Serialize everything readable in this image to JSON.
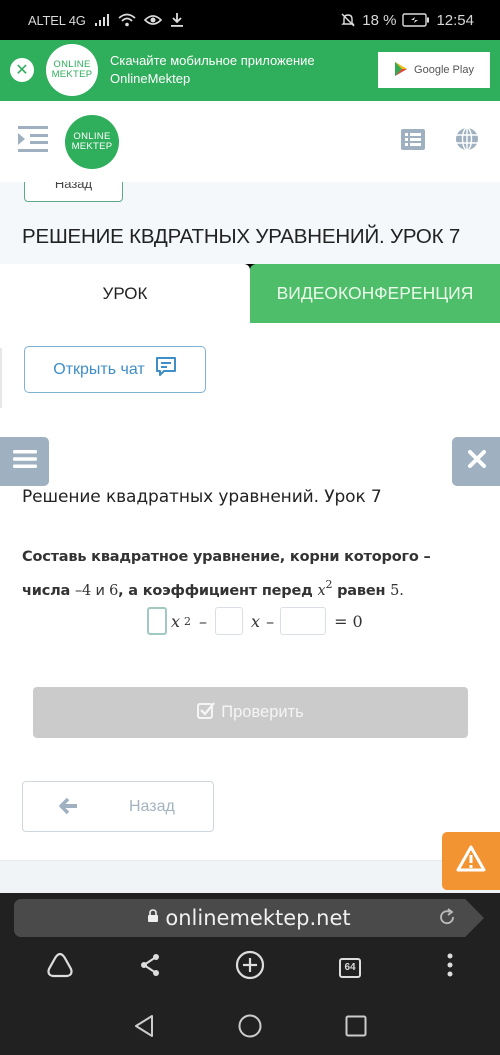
{
  "status_bar": {
    "carrier": "ALTEL 4G",
    "battery": "18 %",
    "time": "12:54"
  },
  "app_banner": {
    "logo_line1": "ONLINE",
    "logo_line2": "MEKTEP",
    "text_line1": "Скачайте мобильное приложение",
    "text_line2": "OnlineMektep",
    "store_button": "Google Play"
  },
  "header": {
    "logo_line1": "ONLINE",
    "logo_line2": "MEKTEP"
  },
  "top_back_button": "Назад",
  "lesson_title": "РЕШЕНИЕ КВДРАТНЫХ УРАВНЕНИЙ. УРОК 7",
  "tabs": [
    {
      "label": "УРОК",
      "active": true
    },
    {
      "label": "ВИДЕОКОНФЕРЕНЦИЯ",
      "active": false
    }
  ],
  "open_chat_button": "Открыть чат",
  "task": {
    "title": "Решение квадратных уравнений. Урок 7",
    "text_part1": "Составь квадратное уравнение, корни которого –",
    "text_part2": "числа ",
    "root1": "–4",
    "conj": " и ",
    "root2": "6",
    "text_part3": ", а коэффициент перед ",
    "var": "x",
    "exp": "2",
    "text_part4": " равен ",
    "coef": "5",
    "period": "."
  },
  "equation": {
    "var": "x",
    "exp": "2",
    "minus1": "–",
    "minus2": "–",
    "rhs": "= 0",
    "inputs": [
      {
        "value": "",
        "placeholder": ""
      },
      {
        "value": "",
        "placeholder": ""
      },
      {
        "value": "",
        "placeholder": ""
      }
    ]
  },
  "check_button": "Проверить",
  "back_button": "Назад",
  "browser": {
    "url": "onlinemektep.net",
    "tab_count": "64"
  },
  "colors": {
    "brand_green": "#2fae5c",
    "tab_green": "#4fbe6a",
    "chat_blue": "#3f8ec8",
    "warning_orange": "#f39433",
    "side_button_gray": "#9fb1c0",
    "disabled_button": "#cbcbcb"
  }
}
